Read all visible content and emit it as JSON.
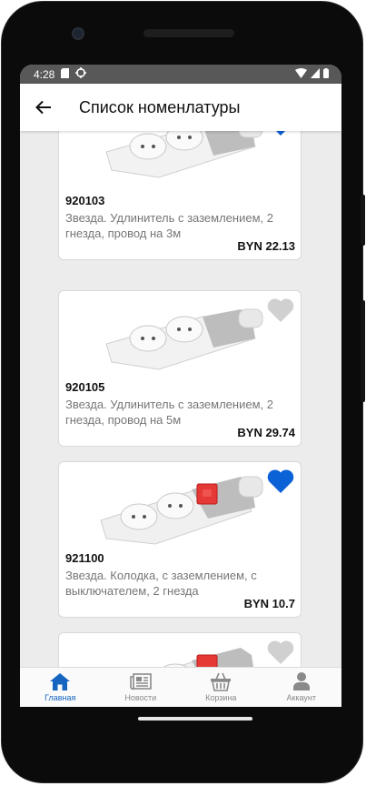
{
  "status": {
    "time": "4:28"
  },
  "header": {
    "title": "Список номенлатуры"
  },
  "products": [
    {
      "code": "920103",
      "description": "Звезда. Удлинитель с заземлением, 2 гнезда, провод на 3м",
      "price": "BYN 22.13",
      "favorite": true,
      "icon": "socket-strip-2-outlets"
    },
    {
      "code": "920105",
      "description": "Звезда. Удлинитель с заземлением, 2 гнезда, провод на 5м",
      "price": "BYN 29.74",
      "favorite": false,
      "icon": "socket-strip-2-outlets"
    },
    {
      "code": "921100",
      "description": "Звезда. Колодка, с заземлением, с выключателем, 2 гнезда",
      "price": "BYN 10.7",
      "favorite": true,
      "icon": "socket-strip-2-outlets-switch"
    },
    {
      "code": "",
      "description": "",
      "price": "",
      "favorite": false,
      "icon": "socket-strip-2-outlets-switch"
    }
  ],
  "bottom_nav": [
    {
      "label": "Главная",
      "icon": "home-icon",
      "active": true
    },
    {
      "label": "Новости",
      "icon": "newspaper-icon",
      "active": false
    },
    {
      "label": "Корзина",
      "icon": "basket-icon",
      "active": false
    },
    {
      "label": "Аккаунт",
      "icon": "account-icon",
      "active": false
    }
  ],
  "colors": {
    "accent": "#1565c0",
    "favorite_on": "#0b62d6",
    "favorite_off": "#d0d0d0",
    "statusbar": "#585858"
  }
}
